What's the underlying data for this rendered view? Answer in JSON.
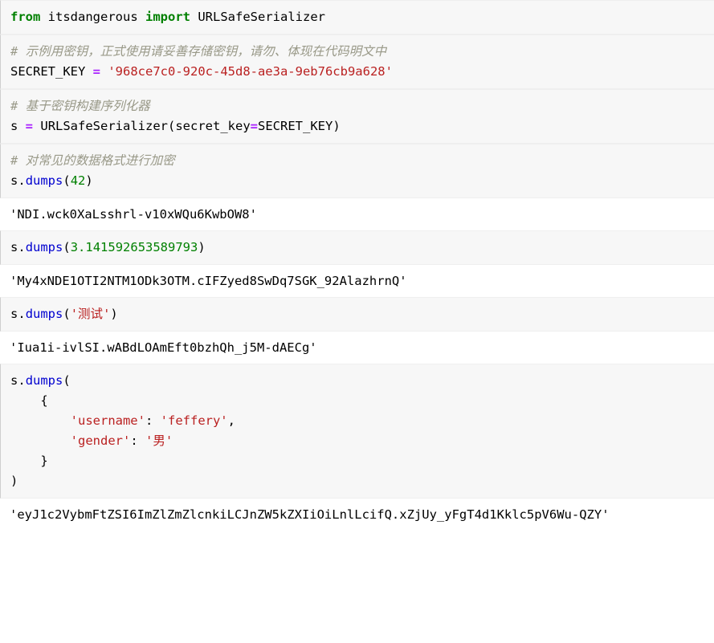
{
  "notebook": {
    "cells": [
      {
        "kind": "input",
        "name": "cell-input-import",
        "lines": [
          {
            "name": "code-line-import",
            "tokens": [
              {
                "t": "from",
                "c": "tok-k"
              },
              {
                "t": " ",
                "c": "tok-p"
              },
              {
                "t": "itsdangerous",
                "c": "tok-n"
              },
              {
                "t": " ",
                "c": "tok-p"
              },
              {
                "t": "import",
                "c": "tok-k"
              },
              {
                "t": " ",
                "c": "tok-p"
              },
              {
                "t": "URLSafeSerializer",
                "c": "tok-n"
              }
            ]
          }
        ]
      },
      {
        "kind": "input",
        "name": "cell-input-secret-key",
        "lines": [
          {
            "name": "code-line-comment-secret",
            "tokens": [
              {
                "t": "# ",
                "c": "tok-c"
              },
              {
                "t": "示例用密钥，正式使用请妥善存储密钥，请勿、体现在代码明文中",
                "c": "tok-cn"
              }
            ]
          },
          {
            "name": "code-line-secret-assign",
            "tokens": [
              {
                "t": "SECRET_KEY ",
                "c": "tok-n"
              },
              {
                "t": "=",
                "c": "tok-o"
              },
              {
                "t": " ",
                "c": "tok-p"
              },
              {
                "t": "'968ce7c0-920c-45d8-ae3a-9eb76cb9a628'",
                "c": "tok-s"
              }
            ]
          }
        ]
      },
      {
        "kind": "input",
        "name": "cell-input-serializer",
        "lines": [
          {
            "name": "code-line-comment-serializer",
            "tokens": [
              {
                "t": "# ",
                "c": "tok-c"
              },
              {
                "t": "基于密钥构建序列化器",
                "c": "tok-cn"
              }
            ]
          },
          {
            "name": "code-line-serializer-assign",
            "tokens": [
              {
                "t": "s ",
                "c": "tok-n"
              },
              {
                "t": "=",
                "c": "tok-o"
              },
              {
                "t": " ",
                "c": "tok-p"
              },
              {
                "t": "URLSafeSerializer",
                "c": "tok-n"
              },
              {
                "t": "(",
                "c": "tok-p"
              },
              {
                "t": "secret_key",
                "c": "tok-n"
              },
              {
                "t": "=",
                "c": "tok-o"
              },
              {
                "t": "SECRET_KEY",
                "c": "tok-n"
              },
              {
                "t": ")",
                "c": "tok-p"
              }
            ]
          }
        ]
      },
      {
        "kind": "input",
        "name": "cell-input-dumps-int",
        "lines": [
          {
            "name": "code-line-comment-encrypt",
            "tokens": [
              {
                "t": "# ",
                "c": "tok-c"
              },
              {
                "t": "对常见的数据格式进行加密",
                "c": "tok-cn"
              }
            ]
          },
          {
            "name": "code-line-dumps-42",
            "tokens": [
              {
                "t": "s",
                "c": "tok-n"
              },
              {
                "t": ".",
                "c": "tok-p"
              },
              {
                "t": "dumps",
                "c": "tok-nf"
              },
              {
                "t": "(",
                "c": "tok-p"
              },
              {
                "t": "42",
                "c": "tok-m"
              },
              {
                "t": ")",
                "c": "tok-p"
              }
            ]
          }
        ]
      },
      {
        "kind": "output",
        "name": "cell-output-dumps-int",
        "lines": [
          {
            "name": "output-line-int",
            "text": "'NDI.wck0XaLsshrl-v10xWQu6KwbOW8'"
          }
        ]
      },
      {
        "kind": "input",
        "name": "cell-input-dumps-float",
        "lines": [
          {
            "name": "code-line-dumps-pi",
            "tokens": [
              {
                "t": "s",
                "c": "tok-n"
              },
              {
                "t": ".",
                "c": "tok-p"
              },
              {
                "t": "dumps",
                "c": "tok-nf"
              },
              {
                "t": "(",
                "c": "tok-p"
              },
              {
                "t": "3.141592653589793",
                "c": "tok-m"
              },
              {
                "t": ")",
                "c": "tok-p"
              }
            ]
          }
        ]
      },
      {
        "kind": "output",
        "name": "cell-output-dumps-float",
        "lines": [
          {
            "name": "output-line-float",
            "text": "'My4xNDE1OTI2NTM1ODk3OTM.cIFZyed8SwDq7SGK_92AlazhrnQ'"
          }
        ]
      },
      {
        "kind": "input",
        "name": "cell-input-dumps-str",
        "lines": [
          {
            "name": "code-line-dumps-str",
            "tokens": [
              {
                "t": "s",
                "c": "tok-n"
              },
              {
                "t": ".",
                "c": "tok-p"
              },
              {
                "t": "dumps",
                "c": "tok-nf"
              },
              {
                "t": "(",
                "c": "tok-p"
              },
              {
                "t": "'",
                "c": "tok-s"
              },
              {
                "t": "测试",
                "c": "tok-s cjk-str"
              },
              {
                "t": "'",
                "c": "tok-s"
              },
              {
                "t": ")",
                "c": "tok-p"
              }
            ]
          }
        ]
      },
      {
        "kind": "output",
        "name": "cell-output-dumps-str",
        "lines": [
          {
            "name": "output-line-str",
            "text": "'Iua1i-ivlSI.wABdLOAmEft0bzhQh_j5M-dAECg'"
          }
        ]
      },
      {
        "kind": "input",
        "name": "cell-input-dumps-dict",
        "lines": [
          {
            "name": "code-line-dumps-dict-open",
            "tokens": [
              {
                "t": "s",
                "c": "tok-n"
              },
              {
                "t": ".",
                "c": "tok-p"
              },
              {
                "t": "dumps",
                "c": "tok-nf"
              },
              {
                "t": "(",
                "c": "tok-p"
              }
            ]
          },
          {
            "name": "code-line-dict-brace-open",
            "tokens": [
              {
                "t": "    {",
                "c": "tok-p"
              }
            ]
          },
          {
            "name": "code-line-dict-username",
            "tokens": [
              {
                "t": "        ",
                "c": "tok-p"
              },
              {
                "t": "'username'",
                "c": "tok-s"
              },
              {
                "t": ": ",
                "c": "tok-p"
              },
              {
                "t": "'feffery'",
                "c": "tok-s"
              },
              {
                "t": ",",
                "c": "tok-p"
              }
            ]
          },
          {
            "name": "code-line-dict-gender",
            "tokens": [
              {
                "t": "        ",
                "c": "tok-p"
              },
              {
                "t": "'gender'",
                "c": "tok-s"
              },
              {
                "t": ": ",
                "c": "tok-p"
              },
              {
                "t": "'",
                "c": "tok-s"
              },
              {
                "t": "男",
                "c": "tok-s cjk-str"
              },
              {
                "t": "'",
                "c": "tok-s"
              }
            ]
          },
          {
            "name": "code-line-dict-brace-close",
            "tokens": [
              {
                "t": "    }",
                "c": "tok-p"
              }
            ]
          },
          {
            "name": "code-line-dumps-dict-close",
            "tokens": [
              {
                "t": ")",
                "c": "tok-p"
              }
            ]
          }
        ]
      },
      {
        "kind": "output",
        "name": "cell-output-dumps-dict",
        "lines": [
          {
            "name": "output-line-dict",
            "text": "'eyJ1c2VybmFtZSI6ImZlZmZlcnkiLCJnZW5kZXIiOiLnlLcifQ.xZjUy_yFgT4d1Kklc5pV6Wu-QZY'"
          }
        ]
      }
    ]
  }
}
